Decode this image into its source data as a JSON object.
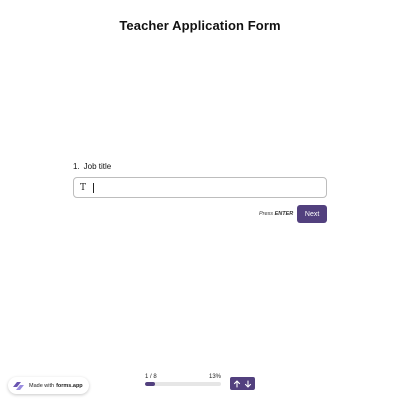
{
  "form": {
    "title": "Teacher Application Form"
  },
  "question": {
    "number": "1.",
    "label": "Job title",
    "input_value": "",
    "input_icon": "text-type-icon"
  },
  "actions": {
    "press_prefix": "Press",
    "press_key": "ENTER",
    "next_label": "Next"
  },
  "footer": {
    "made_with_prefix": "Made with",
    "made_with_brand": "forms.app",
    "progress_step": "1 / 8",
    "progress_percent": "13%",
    "progress_fraction": 0.13,
    "nav_up_icon": "arrow-up-icon",
    "nav_down_icon": "arrow-down-icon"
  },
  "colors": {
    "accent": "#52407e",
    "border": "#bdbdbd",
    "track": "#e6e6e6"
  }
}
